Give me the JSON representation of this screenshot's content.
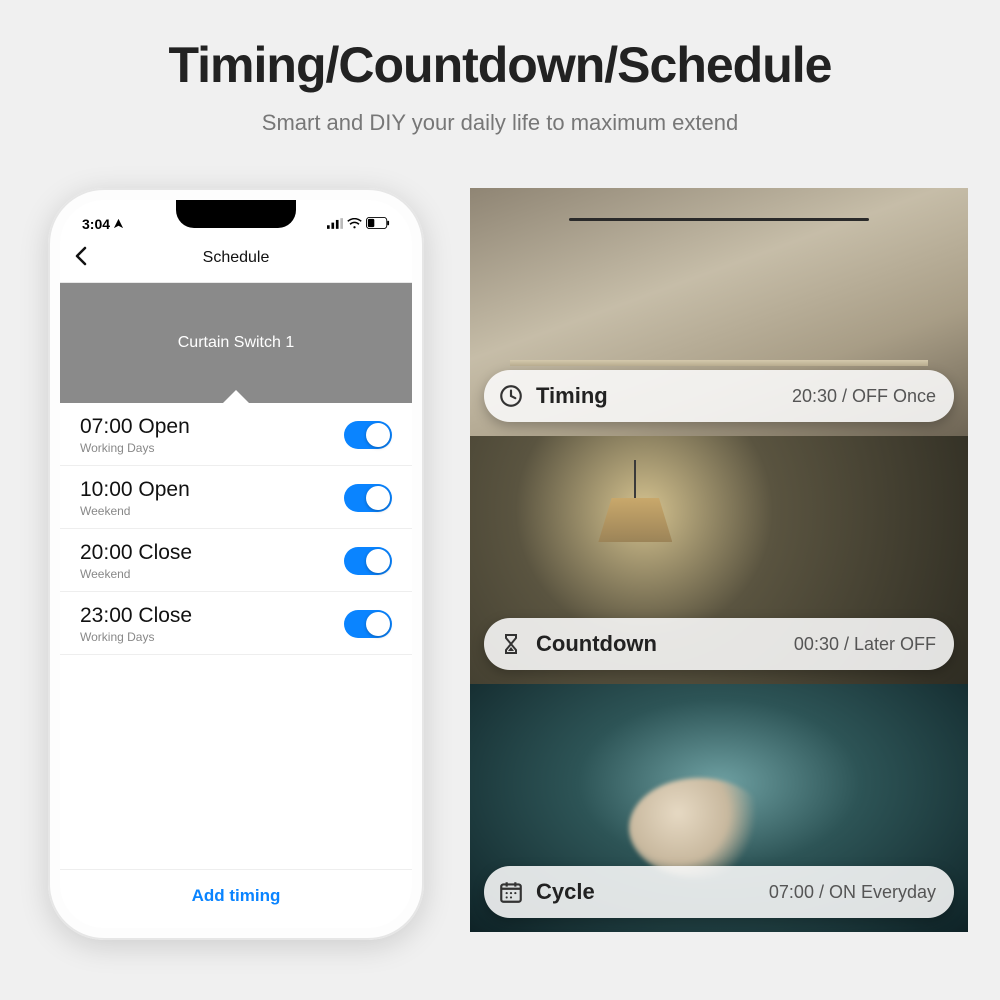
{
  "header": {
    "title": "Timing/Countdown/Schedule",
    "subtitle": "Smart and DIY your daily life to maximum extend"
  },
  "phone": {
    "status_time": "3:04",
    "nav_title": "Schedule",
    "device_name": "Curtain Switch 1",
    "rows": [
      {
        "time": "07:00",
        "action": "Open",
        "days": "Working Days",
        "enabled": true
      },
      {
        "time": "10:00",
        "action": "Open",
        "days": "Weekend",
        "enabled": true
      },
      {
        "time": "20:00",
        "action": "Close",
        "days": "Weekend",
        "enabled": true
      },
      {
        "time": "23:00",
        "action": "Close",
        "days": "Working Days",
        "enabled": true
      }
    ],
    "add_label": "Add timing"
  },
  "panels": [
    {
      "icon": "clock",
      "label": "Timing",
      "value": "20:30 / OFF Once"
    },
    {
      "icon": "hourglass",
      "label": "Countdown",
      "value": "00:30 / Later OFF"
    },
    {
      "icon": "calendar",
      "label": "Cycle",
      "value": "07:00 / ON Everyday"
    }
  ]
}
